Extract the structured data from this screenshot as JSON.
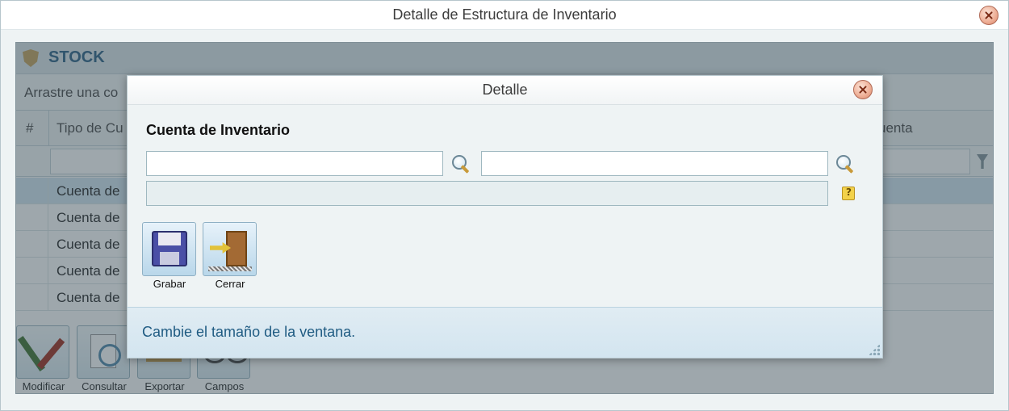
{
  "window": {
    "title": "Detalle de Estructura de Inventario"
  },
  "panel": {
    "title": "STOCK",
    "group_hint": "Arrastre una co",
    "columns": {
      "index": "#",
      "tipo": "Tipo de Cu",
      "cuenta": "uenta"
    },
    "rows": [
      {
        "cell": "Cuenta de"
      },
      {
        "cell": "Cuenta de"
      },
      {
        "cell": "Cuenta de"
      },
      {
        "cell": "Cuenta de"
      },
      {
        "cell": "Cuenta de"
      }
    ],
    "toolbar": [
      {
        "label": "Modificar"
      },
      {
        "label": "Consultar"
      },
      {
        "label": "Exportar"
      },
      {
        "label": "Campos"
      }
    ]
  },
  "dialog": {
    "title": "Detalle",
    "section_title": "Cuenta de Inventario",
    "fields": {
      "code": "",
      "name": "",
      "description": ""
    },
    "buttons": {
      "save": "Grabar",
      "close": "Cerrar"
    },
    "footer": "Cambie el tamaño de la ventana."
  }
}
